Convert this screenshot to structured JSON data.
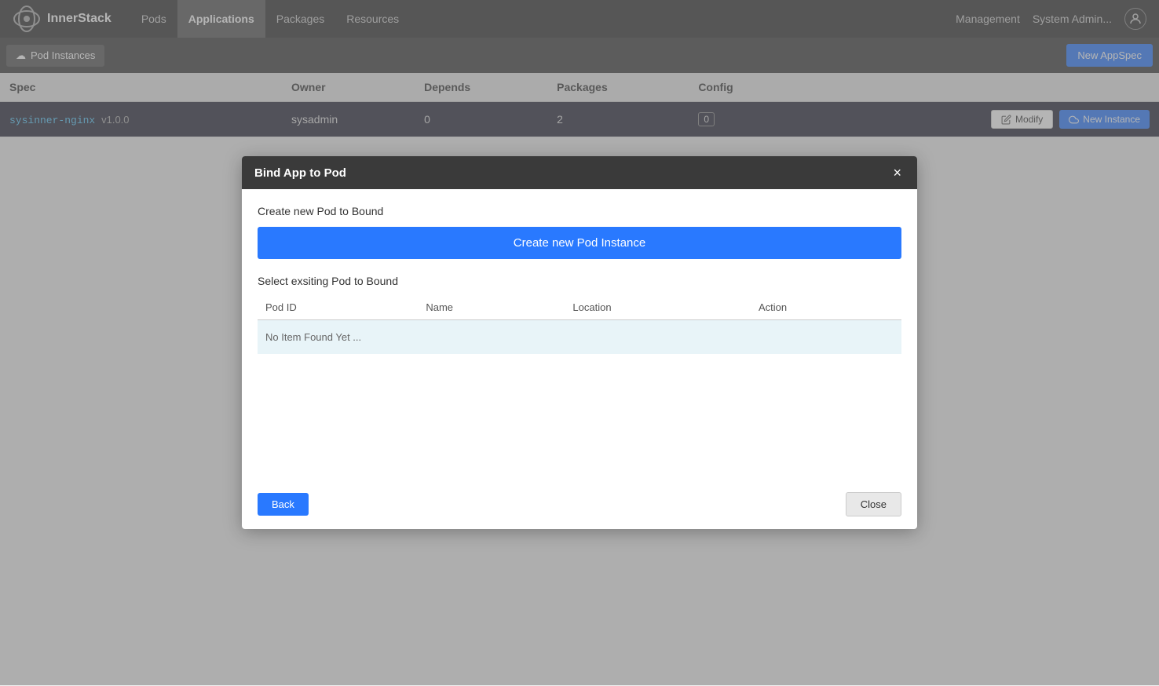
{
  "navbar": {
    "brand": "InnerStack",
    "links": [
      {
        "label": "Pods",
        "active": false
      },
      {
        "label": "Applications",
        "active": true
      },
      {
        "label": "Packages",
        "active": false
      },
      {
        "label": "Resources",
        "active": false
      }
    ],
    "management_label": "Management",
    "user_label": "System Admin..."
  },
  "subtoolbar": {
    "pod_instances_label": "Pod Instances",
    "new_appspec_label": "New AppSpec"
  },
  "table": {
    "headers": [
      "Spec",
      "Owner",
      "Depends",
      "Packages",
      "Config"
    ],
    "rows": [
      {
        "spec_name": "sysinner-nginx",
        "spec_version": "v1.0.0",
        "owner": "sysadmin",
        "depends": "0",
        "packages": "2",
        "config": "0"
      }
    ]
  },
  "row_actions": {
    "modify_label": "Modify",
    "new_instance_label": "New Instance"
  },
  "modal": {
    "title": "Bind App to Pod",
    "create_section_title": "Create new Pod to Bound",
    "create_btn_label": "Create new Pod Instance",
    "select_section_title": "Select exsiting Pod to Bound",
    "pod_table_headers": [
      "Pod ID",
      "Name",
      "Location",
      "Action"
    ],
    "empty_message": "No Item Found Yet ...",
    "back_label": "Back",
    "close_label": "Close"
  },
  "icons": {
    "pod_instances": "☁",
    "modify": "✎",
    "new_instance": "☁",
    "close": "×",
    "user": "👤"
  }
}
